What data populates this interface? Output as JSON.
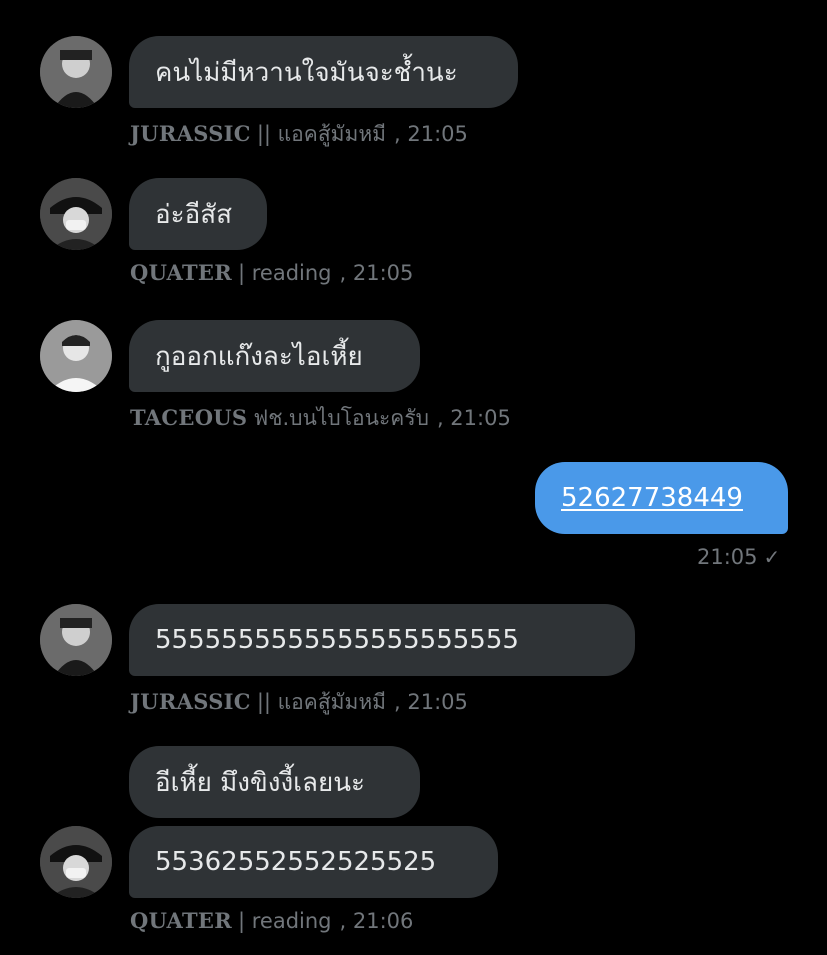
{
  "messages": [
    {
      "text": "คนไม่มีหวานใจมันจะช้ำนะ",
      "sender": "JURASSIC",
      "status": "|| แอคสู้มัมหมี",
      "time": ", 21:05"
    },
    {
      "text": "อ่ะอีสัส",
      "sender": "QUATER",
      "status": "| reading",
      "time": ", 21:05"
    },
    {
      "text": "กูออกแก๊งละไอเหี้ย",
      "sender": "TACEOUS",
      "status": "ฟช.บนไบโอนะครับ",
      "time": ", 21:05"
    },
    {
      "text": "52627738449",
      "time": "21:05",
      "check_icon": "✓"
    },
    {
      "text": "5555555555555555555555",
      "sender": "JURASSIC",
      "status": "|| แอคสู้มัมหมี",
      "time": ", 21:05"
    },
    {
      "text": "อีเหี้ย มึงขิงงี้เลยนะ"
    },
    {
      "text": "55362552552525525",
      "sender": "QUATER",
      "status": "| reading",
      "time": ", 21:06"
    }
  ],
  "colors": {
    "incoming_bubble": "#2f3336",
    "outgoing_bubble": "#4a99e9",
    "meta_text": "#71767b",
    "background": "#000000"
  }
}
